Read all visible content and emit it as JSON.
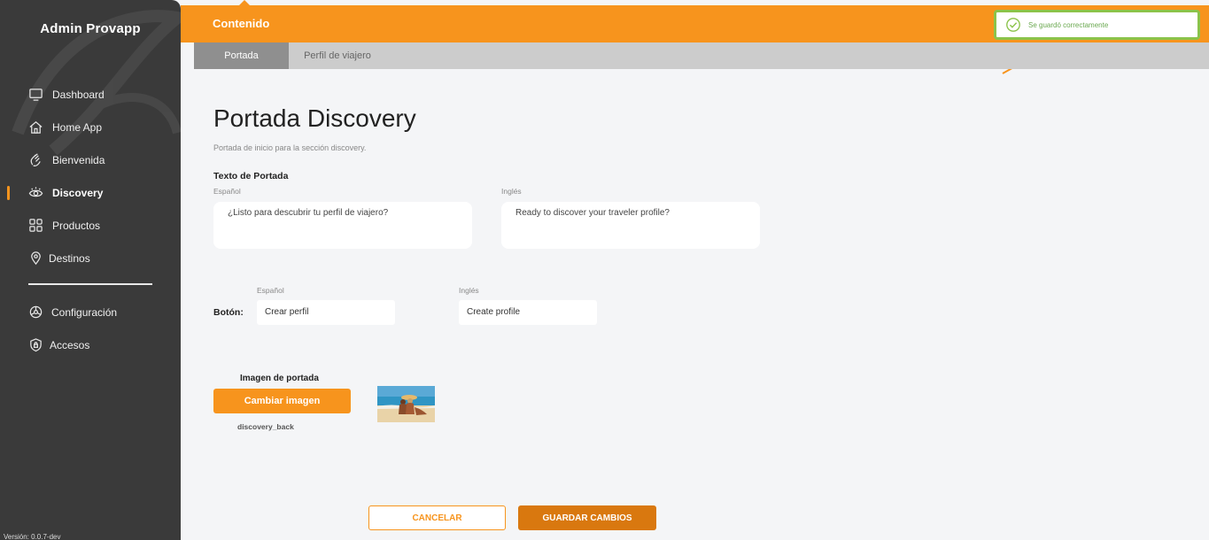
{
  "sidebar": {
    "title": "Admin Provapp",
    "items": [
      {
        "label": "Dashboard",
        "icon": "monitor-icon"
      },
      {
        "label": "Home App",
        "icon": "home-icon"
      },
      {
        "label": "Bienvenida",
        "icon": "wave-hand-icon"
      },
      {
        "label": "Discovery",
        "icon": "eye-icon",
        "active": true
      },
      {
        "label": "Productos",
        "icon": "grid-icon"
      },
      {
        "label": "Destinos",
        "icon": "location-pin-icon"
      }
    ],
    "items2": [
      {
        "label": "Configuración",
        "icon": "gear-icon"
      },
      {
        "label": "Accesos",
        "icon": "shield-icon"
      }
    ],
    "version": "Versión: 0.0.7-dev"
  },
  "header": {
    "title": "Contenido"
  },
  "toast": {
    "message": "Se guardó correctamente",
    "color": "#8bc34a"
  },
  "tabs": [
    {
      "label": "Portada",
      "active": true
    },
    {
      "label": "Perfil de viajero",
      "active": false
    }
  ],
  "main": {
    "title": "Portada Discovery",
    "subtitle": "Portada de inicio para la sección discovery.",
    "cover_text": {
      "section_title": "Texto de Portada",
      "es_label": "Español",
      "es_value": "¿Listo para descubrir tu perfil de viajero?",
      "en_label": "Inglés",
      "en_value": "Ready to discover your traveler profile?"
    },
    "button_text": {
      "label": "Botón:",
      "es_label": "Español",
      "es_value": "Crear perfil",
      "en_label": "Inglés",
      "en_value": "Create profile"
    },
    "cover_image": {
      "title": "Imagen de portada",
      "change_label": "Cambiar imagen",
      "filename": "discovery_back"
    },
    "actions": {
      "cancel_label": "CANCELAR",
      "save_label": "GUARDAR CAMBIOS"
    }
  },
  "colors": {
    "accent": "#f7941d",
    "sidebar_bg": "#3a3a3a",
    "save_button": "#d9780f"
  }
}
